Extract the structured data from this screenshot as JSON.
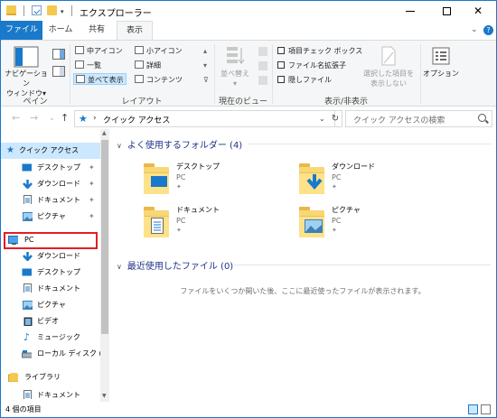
{
  "window": {
    "title": "エクスプローラー",
    "colors": {
      "accent": "#1979ca",
      "highlight_box": "#e31e24",
      "selected": "#cce8ff"
    }
  },
  "ribbon_tabs": [
    "ファイル",
    "ホーム",
    "共有",
    "表示"
  ],
  "ribbon": {
    "groups": {
      "pane": "ペイン",
      "layout": "レイアウト",
      "current_view": "現在のビュー",
      "show_hide": "表示/非表示"
    },
    "nav_pane_button": [
      "ナビゲーション",
      "ウィンドウ▾"
    ],
    "layout_items": [
      "中アイコン",
      "小アイコン",
      "一覧",
      "詳細",
      "並べて表示",
      "コンテンツ"
    ],
    "sort_button": [
      "並べ替え",
      "▾"
    ],
    "checkboxes": [
      "項目チェック ボックス",
      "ファイル名拡張子",
      "隠しファイル"
    ],
    "hide_selected": [
      "選択した項目を",
      "表示しない"
    ],
    "options_button": "オプション"
  },
  "address": {
    "path": "クイック アクセス",
    "search_placeholder": "クイック アクセスの検索"
  },
  "nav_pane": {
    "items": [
      {
        "label": "クイック アクセス",
        "icon": "star-icon",
        "pinned": false
      },
      {
        "label": "デスクトップ",
        "icon": "desktop-icon",
        "pinned": true
      },
      {
        "label": "ダウンロード",
        "icon": "download-icon",
        "pinned": true
      },
      {
        "label": "ドキュメント",
        "icon": "document-icon",
        "pinned": true
      },
      {
        "label": "ピクチャ",
        "icon": "picture-icon",
        "pinned": true
      },
      {
        "label": "PC",
        "icon": "pc-icon",
        "pinned": false
      },
      {
        "label": "ダウンロード",
        "icon": "download-icon",
        "pinned": false
      },
      {
        "label": "デスクトップ",
        "icon": "desktop-icon",
        "pinned": false
      },
      {
        "label": "ドキュメント",
        "icon": "document-icon",
        "pinned": false
      },
      {
        "label": "ピクチャ",
        "icon": "picture-icon",
        "pinned": false
      },
      {
        "label": "ビデオ",
        "icon": "video-icon",
        "pinned": false
      },
      {
        "label": "ミュージック",
        "icon": "music-icon",
        "pinned": false
      },
      {
        "label": "ローカル ディスク (C",
        "icon": "drive-icon",
        "pinned": false
      },
      {
        "label": "ライブラリ",
        "icon": "library-icon",
        "pinned": false
      },
      {
        "label": "ドキュメント",
        "icon": "document-icon",
        "pinned": false
      }
    ]
  },
  "content": {
    "frequent_header": "よく使用するフォルダー (4)",
    "recent_header": "最近使用したファイル (0)",
    "folders": [
      {
        "name": "デスクトップ",
        "location": "PC",
        "icon": "desktop-folder-icon"
      },
      {
        "name": "ダウンロード",
        "location": "PC",
        "icon": "download-folder-icon"
      },
      {
        "name": "ドキュメント",
        "location": "PC",
        "icon": "document-folder-icon"
      },
      {
        "name": "ピクチャ",
        "location": "PC",
        "icon": "picture-folder-icon"
      }
    ],
    "empty_message": "ファイルをいくつか開いた後、ここに最近使ったファイルが表示されます。"
  },
  "status": {
    "text": "4 個の項目"
  }
}
